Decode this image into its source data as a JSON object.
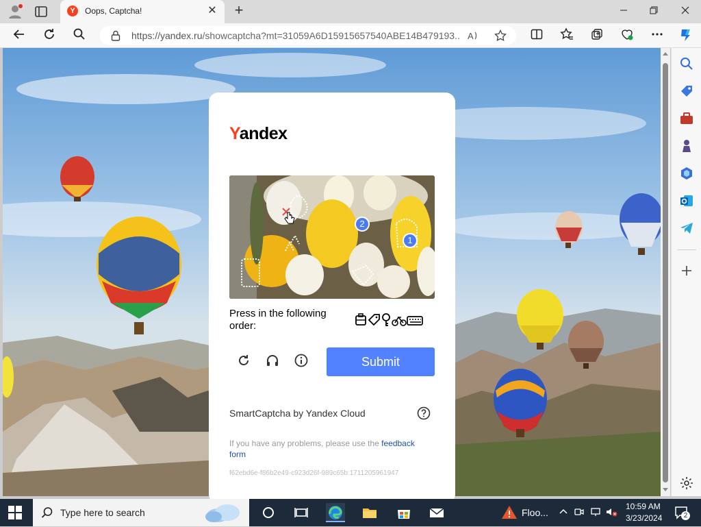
{
  "browser": {
    "tab_title": "Oops, Captcha!",
    "tab_favicon_letter": "Y",
    "url_host": "https://yandex.ru",
    "url_path": "/showcaptcha?mt=31059A6D15915657540ABE14B479193...",
    "new_tab_symbol": "+",
    "close_symbol": "✕"
  },
  "captcha": {
    "logo_first": "Y",
    "logo_rest": "andex",
    "instruction": "Press in the following order:",
    "submit_label": "Submit",
    "brand_text": "SmartCaptcha by Yandex Cloud",
    "problems_prefix": "If you have any problems, please use the",
    "feedback_link": "feedback form",
    "hash": "f62ebd6e-f86b2e49-c923d26f-989c65b:1711205961947",
    "markers": [
      "2",
      "1"
    ],
    "task_icon_names": [
      "bag-icon",
      "tag-icon",
      "key-icon",
      "bicycle-icon",
      "keyboard-icon"
    ]
  },
  "taskbar": {
    "search_placeholder": "Type here to search",
    "weather_label": "Floo...",
    "time": "10:59 AM",
    "date": "3/23/2024",
    "notification_count": "2"
  },
  "colors": {
    "accent_submit": "#5282ff",
    "yandex_red": "#fc3f1d",
    "marker_blue": "#4a7cf7"
  }
}
